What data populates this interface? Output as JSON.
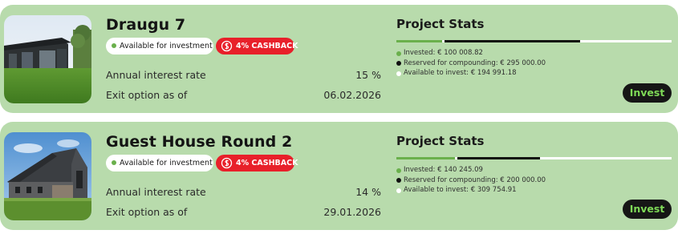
{
  "colors": {
    "card_bg": "#b8dbac",
    "invested": "#6ab04c",
    "reserved": "#111111",
    "available": "#ffffff",
    "cashback": "#e8202a",
    "invest_text": "#7ed957"
  },
  "projects": [
    {
      "title": "Draugu 7",
      "status": "Available for investment",
      "cashback": "4% CASHBACK",
      "interest_label": "Annual interest rate",
      "interest_value": "15 %",
      "exit_label": "Exit option as of",
      "exit_value": "06.02.2026",
      "stats_title": "Project Stats",
      "invested": "Invested: € 100 008.82",
      "reserved": "Reserved for compounding: € 295 000.00",
      "available": "Available to invest: € 194 991.18",
      "invested_amount": 100008.82,
      "reserved_amount": 295000.0,
      "available_amount": 194991.18,
      "invest_button": "Invest",
      "image_icon": "modern-house-photo"
    },
    {
      "title": "Guest House Round 2",
      "status": "Available for investment",
      "cashback": "4% CASHBACK",
      "interest_label": "Annual interest rate",
      "interest_value": "14 %",
      "exit_label": "Exit option as of",
      "exit_value": "29.01.2026",
      "stats_title": "Project Stats",
      "invested": "Invested: € 140 245.09",
      "reserved": "Reserved for compounding: € 200 000.00",
      "available": "Available to invest: € 309 754.91",
      "invested_amount": 140245.09,
      "reserved_amount": 200000.0,
      "available_amount": 309754.91,
      "invest_button": "Invest",
      "image_icon": "guest-house-photo"
    }
  ]
}
